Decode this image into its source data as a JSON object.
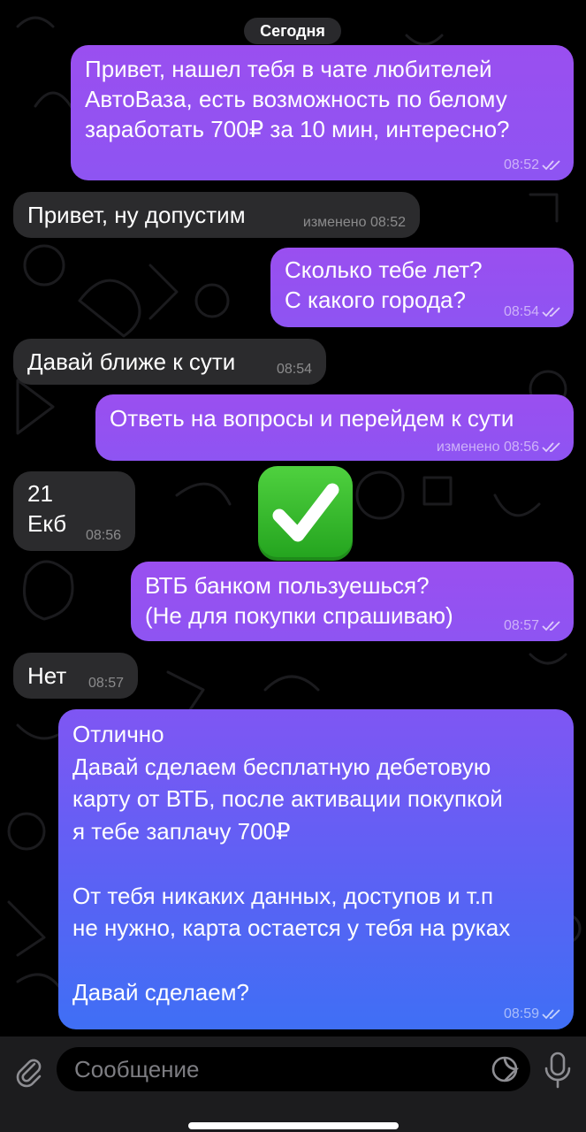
{
  "chat": {
    "date_separator": "Сегодня",
    "messages": [
      {
        "text": "Привет, нашел тебя в чате любителей\nАвтоВаза, есть возможность по белому\nзаработать 700₽ за 10 мин, интересно?",
        "time": "08:52"
      },
      {
        "text": "Привет, ну допустим",
        "time": "изменено 08:52"
      },
      {
        "text": "Сколько тебе лет?\nС какого города?",
        "time": "08:54"
      },
      {
        "text": "Давай ближе к сути",
        "time": "08:54"
      },
      {
        "text": "Ответь на вопросы и перейдем к сути",
        "time": "изменено 08:56"
      },
      {
        "text": "21\nЕкб",
        "time": "08:56"
      },
      {
        "text": "ВТБ банком пользуешься?\n(Не для покупки спрашиваю)",
        "time": "08:57"
      },
      {
        "text": "Нет",
        "time": "08:57"
      },
      {
        "text": "Отлично\nДавай сделаем бесплатную дебетовую\nкарту от ВТБ, после активации покупкой\nя тебе заплачу 700₽\n\nОт тебя никаких данных, доступов и т.п\nне нужно, карта остается у тебя на руках\n\nДавай сделаем?",
        "time": "08:59"
      }
    ],
    "sticker": {
      "icon": "white-check-mark-emoji",
      "color": "#2fb82a"
    }
  },
  "composer": {
    "placeholder": "Сообщение",
    "icons": [
      "paperclip-icon",
      "sticker-icon",
      "microphone-icon"
    ]
  },
  "colors": {
    "background": "#000000",
    "incoming_bubble": "#2b2b2d",
    "outgoing_bubble_top": "#9a4ff0",
    "outgoing_bubble_bottom": "#3f6ff5",
    "composer_bar": "#1c1c1e"
  }
}
